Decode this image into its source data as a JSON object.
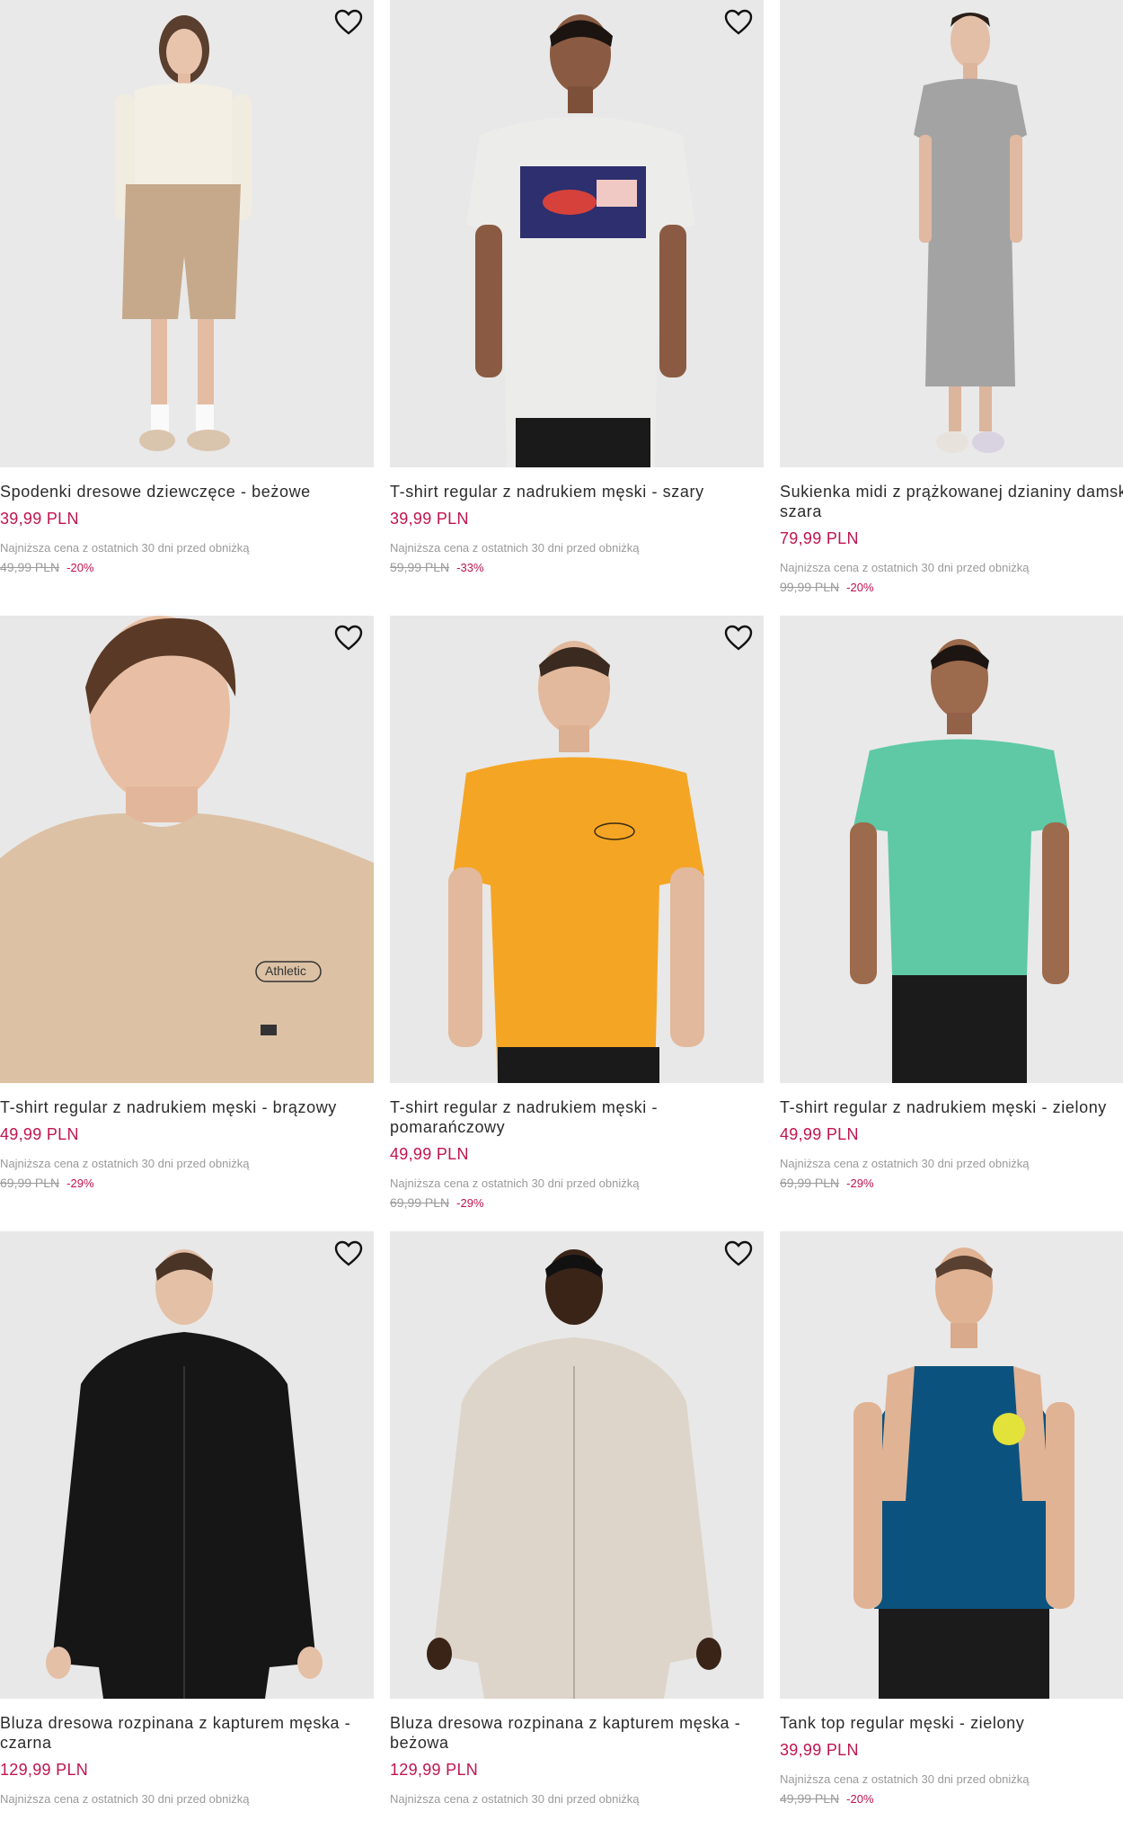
{
  "colors": {
    "price": "#c0144f",
    "muted": "#9a9a9a",
    "photo_bg": "#e8e8e8"
  },
  "wishlist_icon": "heart-outline-icon",
  "products": [
    {
      "title": "Spodenki dresowe dziewczęce - beżowe",
      "price": "39,99 PLN",
      "lowest_label": "Najniższa cena z ostatnich 30 dni przed obniżką",
      "old_price": "49,99 PLN",
      "discount": "-20%",
      "photo": "girl-shorts-photo"
    },
    {
      "title": "T-shirt regular z nadrukiem męski - szary",
      "price": "39,99 PLN",
      "lowest_label": "Najniższa cena z ostatnich 30 dni przed obniżką",
      "old_price": "59,99 PLN",
      "discount": "-33%",
      "photo": "grey-tshirt-photo"
    },
    {
      "title": "Sukienka midi z prążkowanej dzianiny damska - szara",
      "price": "79,99 PLN",
      "lowest_label": "Najniższa cena z ostatnich 30 dni przed obniżką",
      "old_price": "99,99 PLN",
      "discount": "-20%",
      "photo": "grey-dress-photo"
    },
    {
      "title": "T-shirt regular z nadrukiem męski - brązowy",
      "price": "49,99 PLN",
      "lowest_label": "Najniższa cena z ostatnich 30 dni przed obniżką",
      "old_price": "69,99 PLN",
      "discount": "-29%",
      "photo": "beige-tshirt-photo"
    },
    {
      "title": "T-shirt regular z nadrukiem męski - pomarańczowy",
      "price": "49,99 PLN",
      "lowest_label": "Najniższa cena z ostatnich 30 dni przed obniżką",
      "old_price": "69,99 PLN",
      "discount": "-29%",
      "photo": "orange-tshirt-photo"
    },
    {
      "title": "T-shirt regular z nadrukiem męski - zielony",
      "price": "49,99 PLN",
      "lowest_label": "Najniższa cena z ostatnich 30 dni przed obniżką",
      "old_price": "69,99 PLN",
      "discount": "-29%",
      "photo": "green-tshirt-photo"
    },
    {
      "title": "Bluza dresowa rozpinana z kapturem męska - czarna",
      "price": "129,99 PLN",
      "lowest_label": "Najniższa cena z ostatnich 30 dni przed obniżką",
      "old_price": "",
      "discount": "",
      "photo": "black-hoodie-photo"
    },
    {
      "title": "Bluza dresowa rozpinana z kapturem męska - beżowa",
      "price": "129,99 PLN",
      "lowest_label": "Najniższa cena z ostatnich 30 dni przed obniżką",
      "old_price": "",
      "discount": "",
      "photo": "beige-hoodie-photo"
    },
    {
      "title": "Tank top regular męski - zielony",
      "price": "39,99 PLN",
      "lowest_label": "Najniższa cena z ostatnich 30 dni przed obniżką",
      "old_price": "49,99 PLN",
      "discount": "-20%",
      "photo": "blue-tanktop-photo"
    }
  ]
}
